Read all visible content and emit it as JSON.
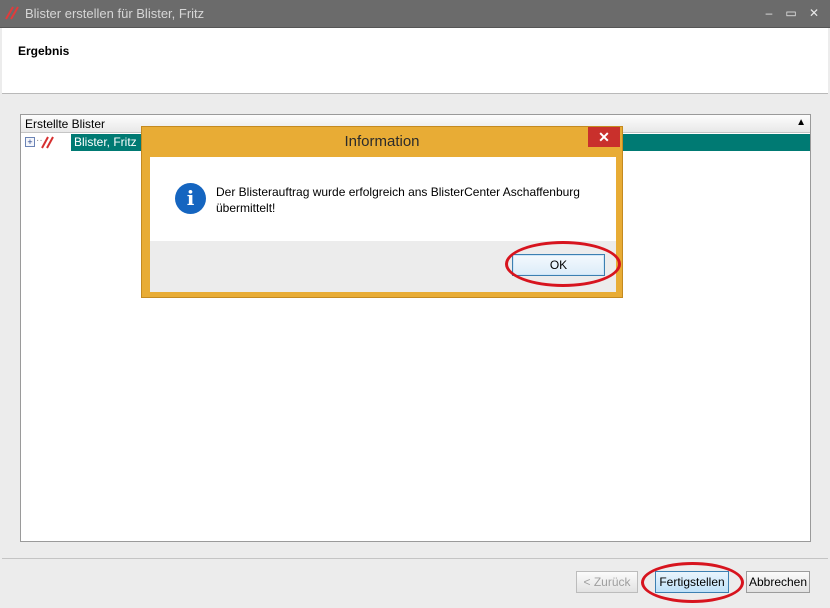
{
  "window": {
    "title": "Blister erstellen für Blister, Fritz",
    "icon": "blister-app-icon",
    "controls": {
      "minimize": "–",
      "maximize": "▭",
      "close": "✕"
    }
  },
  "header": {
    "title": "Ergebnis"
  },
  "tree": {
    "header_label": "Erstellte Blister",
    "header_caret": "▲",
    "rows": [
      {
        "label": "Blister, Fritz",
        "expand_glyph": "+",
        "icon": "blister-icon",
        "selected": true
      }
    ]
  },
  "dialog": {
    "title": "Information",
    "close_label": "✕",
    "icon": "info-icon",
    "icon_glyph": "i",
    "message": "Der Blisterauftrag wurde erfolgreich ans BlisterCenter Aschaffenburg übermittelt!",
    "ok_label": "OK"
  },
  "footer": {
    "back_label": "< Zurück",
    "finish_label": "Fertigstellen",
    "cancel_label": "Abbrechen"
  },
  "colors": {
    "titlebar": "#6b6b6b",
    "selection": "#007a73",
    "dialog_frame": "#e8ac35",
    "highlight_ring": "#d7141e",
    "info_icon": "#1565c0"
  }
}
